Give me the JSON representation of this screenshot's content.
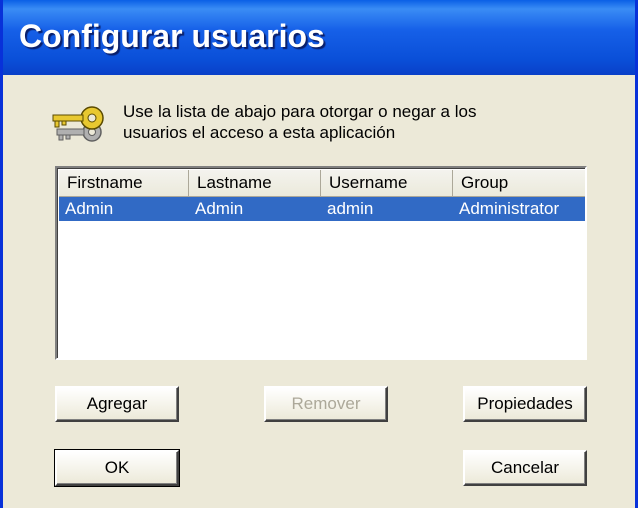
{
  "window": {
    "title": "Configurar usuarios"
  },
  "description": {
    "line1": "Use la lista de abajo para otorgar o negar a los",
    "line2": "usuarios el acceso a esta aplicación"
  },
  "icon": "keys-icon",
  "table": {
    "columns": [
      "Firstname",
      "Lastname",
      "Username",
      "Group"
    ],
    "rows": [
      {
        "firstname": "Admin",
        "lastname": "Admin",
        "username": "admin",
        "group": "Administrator",
        "selected": true
      }
    ]
  },
  "buttons": {
    "add": {
      "label": "Agregar",
      "enabled": true
    },
    "remove": {
      "label": "Remover",
      "enabled": false
    },
    "properties": {
      "label": "Propiedades",
      "enabled": true
    },
    "ok": {
      "label": "OK",
      "enabled": true
    },
    "cancel": {
      "label": "Cancelar",
      "enabled": true
    }
  },
  "colors": {
    "titlebar": "#0a4fd8",
    "dialog_bg": "#ece9d8",
    "selection": "#316ac5"
  }
}
